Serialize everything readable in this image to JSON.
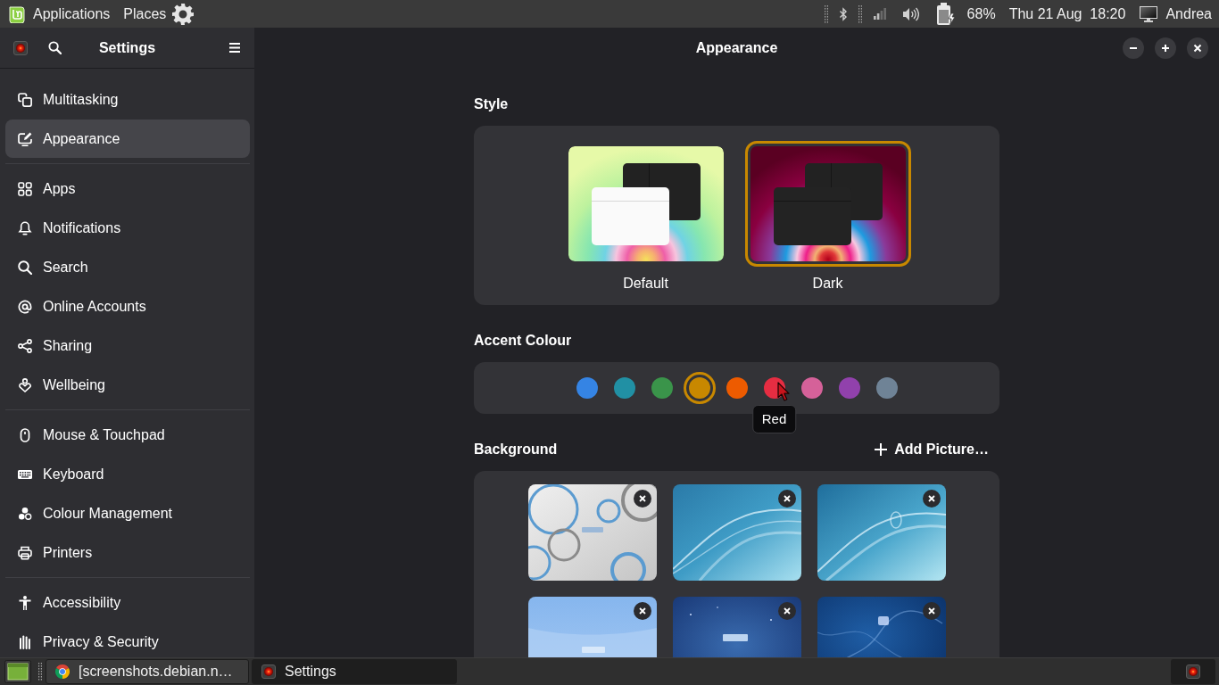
{
  "top_panel": {
    "menus": [
      "Applications",
      "Places"
    ],
    "battery": "68%",
    "clock": "Thu 21 Aug  18:20",
    "user": "Andrea"
  },
  "sidebar": {
    "title": "Settings",
    "groups": [
      {
        "items": [
          {
            "label": "Multitasking",
            "selected": false
          },
          {
            "label": "Appearance",
            "selected": true
          }
        ]
      },
      {
        "items": [
          {
            "label": "Apps",
            "selected": false
          },
          {
            "label": "Notifications",
            "selected": false
          },
          {
            "label": "Search",
            "selected": false
          },
          {
            "label": "Online Accounts",
            "selected": false
          },
          {
            "label": "Sharing",
            "selected": false
          },
          {
            "label": "Wellbeing",
            "selected": false
          }
        ]
      },
      {
        "items": [
          {
            "label": "Mouse & Touchpad",
            "selected": false
          },
          {
            "label": "Keyboard",
            "selected": false
          },
          {
            "label": "Colour Management",
            "selected": false
          },
          {
            "label": "Printers",
            "selected": false
          }
        ]
      },
      {
        "items": [
          {
            "label": "Accessibility",
            "selected": false
          },
          {
            "label": "Privacy & Security",
            "selected": false
          }
        ]
      }
    ]
  },
  "window": {
    "title": "Appearance"
  },
  "style": {
    "title": "Style",
    "options": [
      {
        "label": "Default",
        "kind": "light",
        "selected": false
      },
      {
        "label": "Dark",
        "kind": "dark",
        "selected": true
      }
    ]
  },
  "accent_colour": {
    "title": "Accent Colour",
    "tooltip": "Red",
    "swatches": [
      {
        "color": "#3584e4",
        "selected": false,
        "hovered": false
      },
      {
        "color": "#2190a4",
        "selected": false,
        "hovered": false
      },
      {
        "color": "#3a944a",
        "selected": false,
        "hovered": false
      },
      {
        "color": "#c88800",
        "selected": true,
        "hovered": false
      },
      {
        "color": "#ed5b00",
        "selected": false,
        "hovered": false
      },
      {
        "color": "#e62d42",
        "selected": false,
        "hovered": true
      },
      {
        "color": "#d56199",
        "selected": false,
        "hovered": false
      },
      {
        "color": "#9141ac",
        "selected": false,
        "hovered": false
      },
      {
        "color": "#6f8396",
        "selected": false,
        "hovered": false
      }
    ]
  },
  "background": {
    "title": "Background",
    "add_button": "Add Picture…",
    "wallpapers": [
      {
        "kind": "rings"
      },
      {
        "kind": "waves"
      },
      {
        "kind": "numeral"
      },
      {
        "kind": "sky"
      },
      {
        "kind": "starry"
      },
      {
        "kind": "frost"
      }
    ]
  },
  "taskbar": {
    "windows": [
      {
        "title": "[screenshots.debian.n…",
        "selected": false
      },
      {
        "title": "Settings",
        "selected": true
      }
    ]
  }
}
